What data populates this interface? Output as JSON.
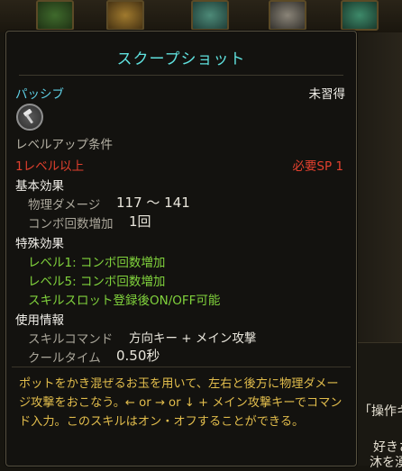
{
  "background": {
    "side_text_1": "「操作キ",
    "side_text_2": "好きさ",
    "side_text_3": "沐を湧"
  },
  "tooltip": {
    "title": "スクープショット",
    "type_label": "パッシブ",
    "learn_status": "未習得",
    "skill_icon": "hammer-icon",
    "level_req_header": "レベルアップ条件",
    "level_req": "1レベル以上",
    "sp_req": "必要SP 1",
    "basic_effects_header": "基本効果",
    "physical_damage_label": "物理ダメージ",
    "physical_damage_value": "117 ～ 141",
    "combo_label": "コンボ回数増加",
    "combo_value": "1回",
    "special_effects_header": "特殊効果",
    "special_effects": [
      "レベル1: コンボ回数増加",
      "レベル5: コンボ回数増加",
      "スキルスロット登録後ON/OFF可能"
    ],
    "usage_header": "使用情報",
    "skill_command_label": "スキルコマンド",
    "skill_command_value": "方向キー + メイン攻撃",
    "cooldown_label": "クールタイム",
    "cooldown_value": "0.50秒",
    "description": "ポットをかき混ぜるお玉を用いて、左右と後方に物理ダメージ攻撃をおこなう。← or → or ↓ + メイン攻撃キーでコマンド入力。このスキルはオン・オフすることができる。"
  },
  "colors": {
    "title": "#5fe0dd",
    "type": "#5fd0e6",
    "requirement": "#e2402e",
    "special": "#80d23c",
    "description": "#e2bd4c"
  }
}
